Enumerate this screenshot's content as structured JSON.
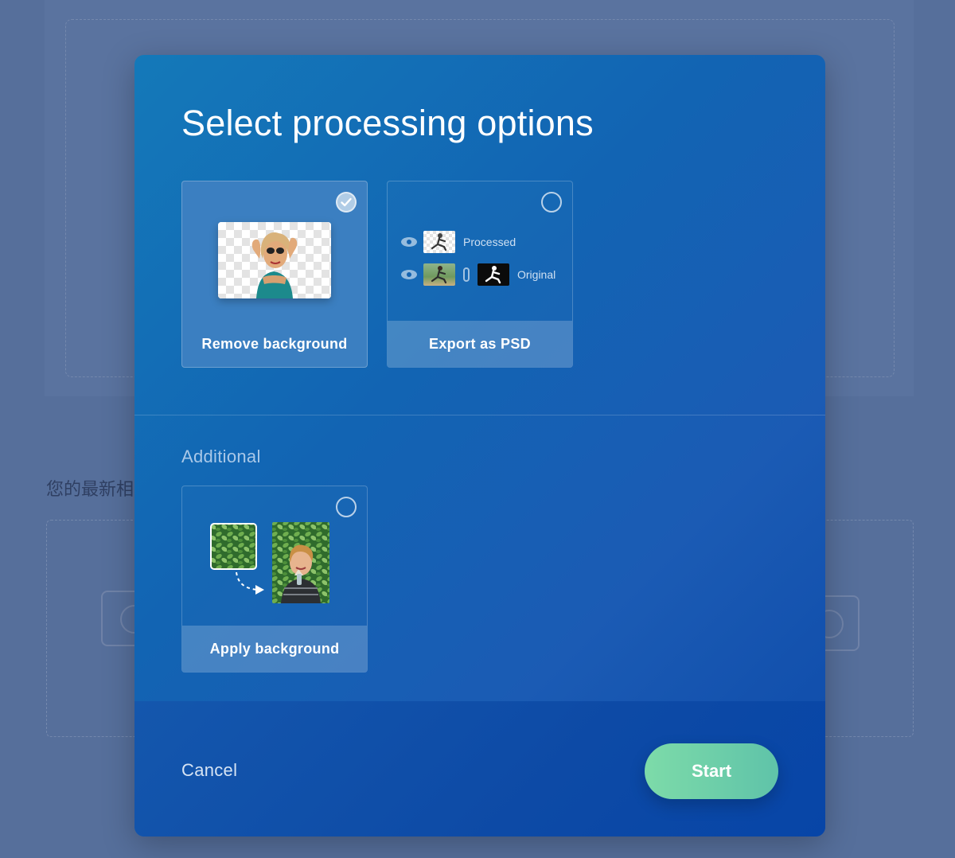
{
  "background_page": {
    "section_title": "您的最新相"
  },
  "modal": {
    "title": "Select processing options",
    "options": [
      {
        "label": "Remove background",
        "selected": true
      },
      {
        "label": "Export as PSD",
        "selected": false,
        "layers": [
          {
            "label": "Processed"
          },
          {
            "label": "Original"
          }
        ]
      }
    ],
    "additional": {
      "heading": "Additional",
      "options": [
        {
          "label": "Apply background",
          "selected": false
        }
      ]
    },
    "footer": {
      "cancel_label": "Cancel",
      "start_label": "Start"
    }
  },
  "colors": {
    "modal_gradient_start": "#1479b9",
    "modal_gradient_end": "#0d4aa9",
    "start_button_start": "#7ddba9",
    "start_button_end": "#5fc3a9",
    "overlay": "#566f9b"
  }
}
